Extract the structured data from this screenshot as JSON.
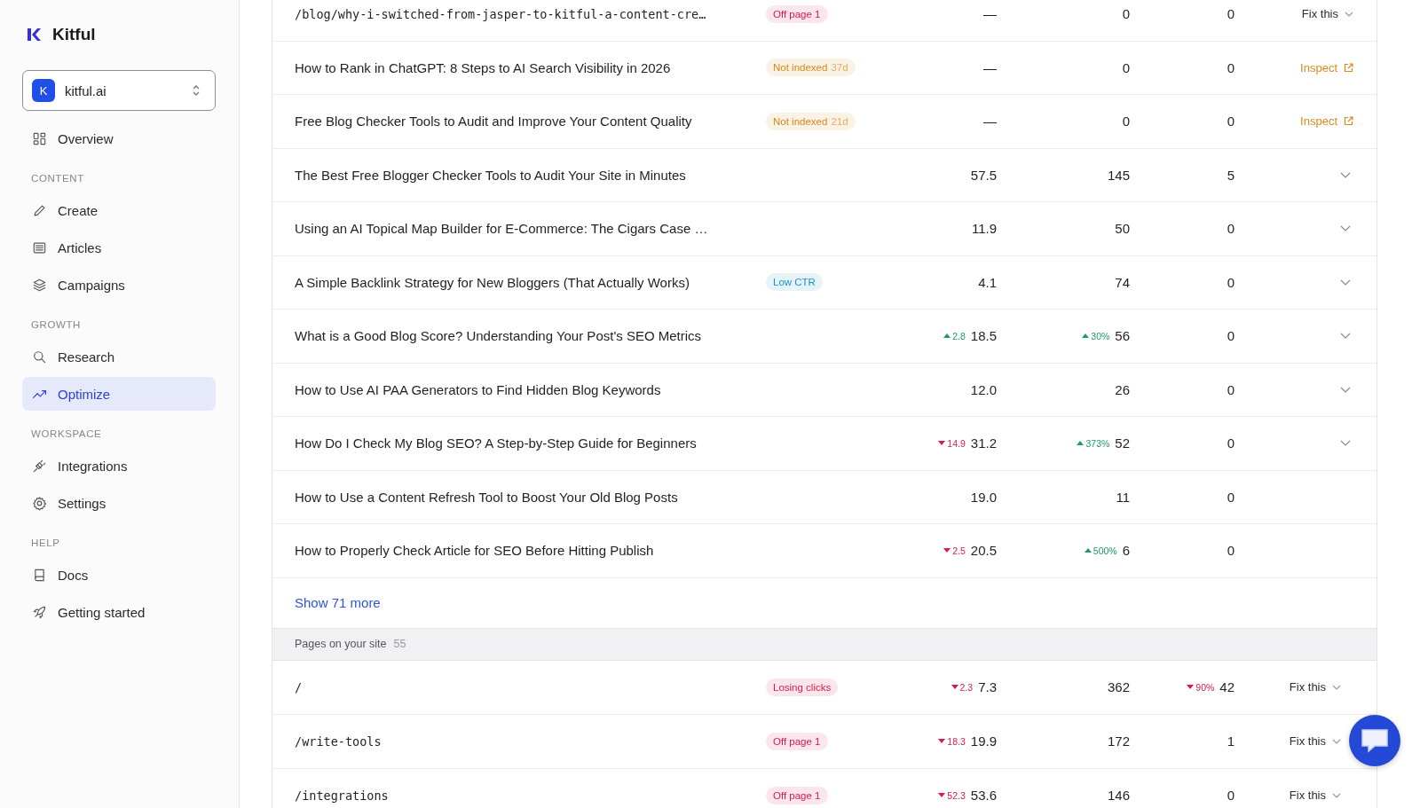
{
  "sidebar": {
    "brand": "Kitful",
    "workspace": {
      "initial": "K",
      "name": "kitful.ai"
    },
    "sections": [
      {
        "items": [
          {
            "label": "Overview",
            "selected": false
          }
        ]
      },
      {
        "heading": "CONTENT",
        "items": [
          {
            "label": "Create",
            "selected": false
          },
          {
            "label": "Articles",
            "selected": false
          },
          {
            "label": "Campaigns",
            "selected": false
          }
        ]
      },
      {
        "heading": "GROWTH",
        "items": [
          {
            "label": "Research",
            "selected": false
          },
          {
            "label": "Optimize",
            "selected": true
          }
        ]
      },
      {
        "heading": "WORKSPACE",
        "items": [
          {
            "label": "Integrations",
            "selected": false
          },
          {
            "label": "Settings",
            "selected": false
          }
        ]
      },
      {
        "heading": "HELP",
        "items": [
          {
            "label": "Docs",
            "selected": false
          },
          {
            "label": "Getting started",
            "selected": false
          }
        ]
      }
    ]
  },
  "table": {
    "rows": [
      {
        "kind": "path",
        "title": "/blog/why-i-switched-from-jasper-to-kitful-a-content-cre…",
        "badge": {
          "label": "Off page 1",
          "color": "#d8194f"
        },
        "metric_1": {
          "value": "—"
        },
        "metric_2": {
          "value": "0"
        },
        "metric_3": {
          "value": "0"
        },
        "action": {
          "kind": "fix",
          "label": "Fix this"
        }
      },
      {
        "kind": "title",
        "title": "How to Rank in ChatGPT: 8 Steps to AI Search Visibility in 2026",
        "badge": {
          "label": "Not indexed",
          "age": "37d",
          "color": "#d9861b"
        },
        "metric_1": {
          "value": "—"
        },
        "metric_2": {
          "value": "0"
        },
        "metric_3": {
          "value": "0"
        },
        "action": {
          "kind": "inspect",
          "label": "Inspect"
        }
      },
      {
        "kind": "title",
        "title": "Free Blog Checker Tools to Audit and Improve Your Content Quality",
        "badge": {
          "label": "Not indexed",
          "age": "21d",
          "color": "#d9861b"
        },
        "metric_1": {
          "value": "—"
        },
        "metric_2": {
          "value": "0"
        },
        "metric_3": {
          "value": "0"
        },
        "action": {
          "kind": "inspect",
          "label": "Inspect"
        }
      },
      {
        "kind": "title",
        "title": "The Best Free Blogger Checker Tools to Audit Your Site in Minutes",
        "metric_1": {
          "value": "57.5"
        },
        "metric_2": {
          "value": "145"
        },
        "metric_3": {
          "value": "5"
        },
        "action": {
          "kind": "expand"
        }
      },
      {
        "kind": "title",
        "title": "Using an AI Topical Map Builder for E-Commerce: The Cigars Case …",
        "metric_1": {
          "value": "11.9"
        },
        "metric_2": {
          "value": "50"
        },
        "metric_3": {
          "value": "0"
        },
        "action": {
          "kind": "expand"
        }
      },
      {
        "kind": "title",
        "title": "A Simple Backlink Strategy for New Bloggers (That Actually Works)",
        "badge": {
          "label": "Low CTR",
          "color": "#1f8fc8"
        },
        "metric_1": {
          "value": "4.1"
        },
        "metric_2": {
          "value": "74"
        },
        "metric_3": {
          "value": "0"
        },
        "action": {
          "kind": "expand"
        }
      },
      {
        "kind": "title",
        "title": "What is a Good Blog Score? Understanding Your Post's SEO Metrics",
        "metric_1": {
          "value": "18.5",
          "delta": "2.8",
          "kind": "rise"
        },
        "metric_2": {
          "value": "56",
          "delta": "30%",
          "kind": "rise"
        },
        "metric_3": {
          "value": "0"
        },
        "action": {
          "kind": "expand"
        }
      },
      {
        "kind": "title",
        "title": "How to Use AI PAA Generators to Find Hidden Blog Keywords",
        "metric_1": {
          "value": "12.0"
        },
        "metric_2": {
          "value": "26"
        },
        "metric_3": {
          "value": "0"
        },
        "action": {
          "kind": "expand"
        }
      },
      {
        "kind": "title",
        "title": "How Do I Check My Blog SEO? A Step-by-Step Guide for Beginners",
        "metric_1": {
          "value": "31.2",
          "delta": "14.9",
          "kind": "fall"
        },
        "metric_2": {
          "value": "52",
          "delta": "373%",
          "kind": "rise"
        },
        "metric_3": {
          "value": "0"
        },
        "action": {
          "kind": "expand"
        }
      },
      {
        "kind": "title",
        "title": "How to Use a Content Refresh Tool to Boost Your Old Blog Posts",
        "metric_1": {
          "value": "19.0"
        },
        "metric_2": {
          "value": "11"
        },
        "metric_3": {
          "value": "0"
        }
      },
      {
        "kind": "title",
        "title": "How to Properly Check Article for SEO Before Hitting Publish",
        "metric_1": {
          "value": "20.5",
          "delta": "2.5",
          "kind": "fall"
        },
        "metric_2": {
          "value": "6",
          "delta": "500%",
          "kind": "rise"
        },
        "metric_3": {
          "value": "0"
        }
      }
    ],
    "show_more": "Show 71 more",
    "section": {
      "title": "Pages on your site",
      "count": "55",
      "rows": [
        {
          "kind": "path",
          "title": "/",
          "badge": {
            "label": "Losing clicks",
            "color": "#d8194f"
          },
          "metric_1": {
            "value": "7.3",
            "delta": "2.3",
            "kind": "fall"
          },
          "metric_2": {
            "value": "362"
          },
          "metric_3": {
            "value": "42",
            "delta": "90%",
            "kind": "fall"
          },
          "action": {
            "kind": "fix",
            "label": "Fix this"
          }
        },
        {
          "kind": "path",
          "title": "/write-tools",
          "badge": {
            "label": "Off page 1",
            "color": "#d8194f"
          },
          "metric_1": {
            "value": "19.9",
            "delta": "18.3",
            "kind": "fall"
          },
          "metric_2": {
            "value": "172"
          },
          "metric_3": {
            "value": "1"
          },
          "action": {
            "kind": "fix",
            "label": "Fix this"
          }
        },
        {
          "kind": "path",
          "title": "/integrations",
          "badge": {
            "label": "Off page 1",
            "color": "#d8194f"
          },
          "metric_1": {
            "value": "53.6",
            "delta": "52.3",
            "kind": "fall"
          },
          "metric_2": {
            "value": "146"
          },
          "metric_3": {
            "value": "0"
          },
          "action": {
            "kind": "fix",
            "label": "Fix this"
          }
        }
      ]
    }
  }
}
